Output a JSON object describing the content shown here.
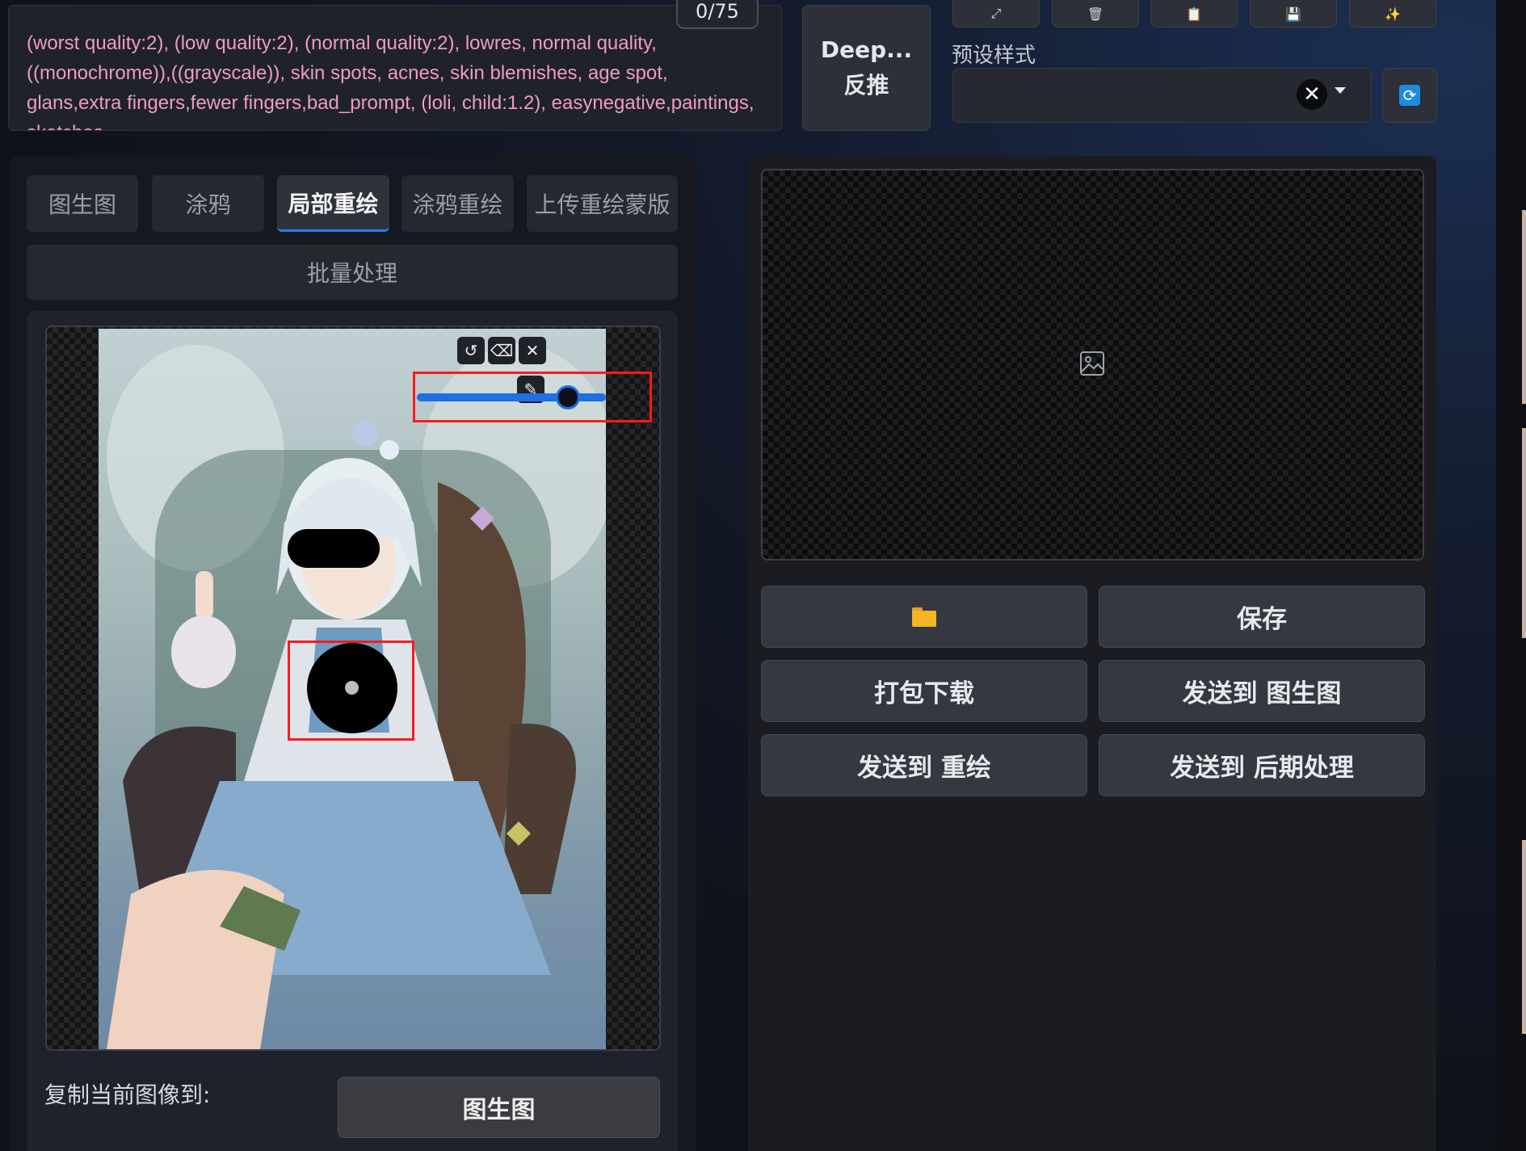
{
  "negative_prompt": {
    "text": "(worst quality:2), (low quality:2), (normal quality:2), lowres, normal quality, ((monochrome)),((grayscale)), skin spots, acnes, skin blemishes, age spot, glans,extra fingers,fewer fingers,bad_prompt, (loli, child:1.2), easynegative,paintings, sketches",
    "token_counter": "0/75"
  },
  "interrogate": {
    "line1": "Deep...",
    "line2": "反推"
  },
  "toolbar": {
    "icons": [
      "arrows-icon",
      "trash-icon",
      "clipboard-icon",
      "save-icon",
      "magic-wand-icon"
    ]
  },
  "styles": {
    "label": "预设样式",
    "clear_glyph": "✕"
  },
  "tabs": [
    {
      "label": "图生图",
      "active": false
    },
    {
      "label": "涂鸦",
      "active": false
    },
    {
      "label": "局部重绘",
      "active": true
    },
    {
      "label": "涂鸦重绘",
      "active": false
    },
    {
      "label": "上传重绘蒙版",
      "active": false
    }
  ],
  "batch_tab": {
    "label": "批量处理"
  },
  "canvas": {
    "buttons": [
      "undo-icon",
      "eraser-icon",
      "close-icon",
      "brush-icon"
    ],
    "brush_size_fraction": 0.8
  },
  "copy_to": {
    "label": "复制当前图像到:",
    "button": "图生图"
  },
  "output": {
    "buttons": [
      {
        "label": "",
        "icon": "folder-icon"
      },
      {
        "label": "保存"
      },
      {
        "label": "打包下载"
      },
      {
        "label": "发送到 图生图"
      },
      {
        "label": "发送到 重绘"
      },
      {
        "label": "发送到 后期处理"
      }
    ]
  },
  "colors": {
    "accent": "#1f6fe5",
    "highlight_box": "#ff1a1a",
    "prompt_text": "#f09bc4"
  }
}
